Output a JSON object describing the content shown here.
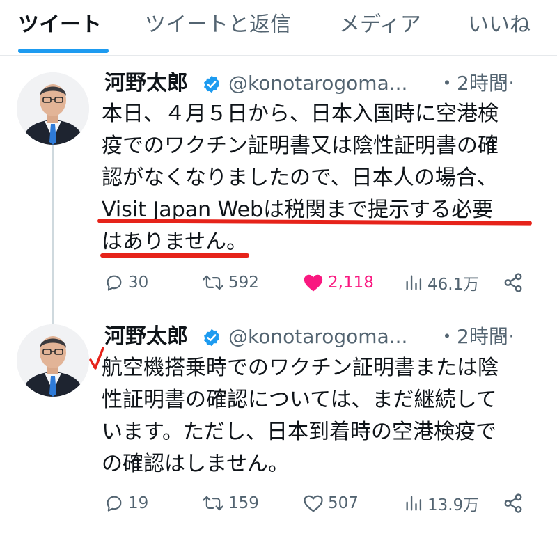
{
  "tabs": [
    {
      "label": "ツイート",
      "active": true
    },
    {
      "label": "ツイートと返信",
      "active": false
    },
    {
      "label": "メディア",
      "active": false
    },
    {
      "label": "いいね",
      "active": false
    }
  ],
  "accent_color": "#1d9bf0",
  "like_color": "#f91880",
  "annotation_color": "#e6231a",
  "tweets": [
    {
      "author_name": "河野太郎",
      "handle": "@konotarogoma...",
      "time": "・2時間",
      "more": "···",
      "lines": [
        "本日、４月５日から、日本入国時に空港検",
        "疫でのワクチン証明書又は陰性証明書の確",
        "認がなくなりましたので、日本人の場合、",
        "Visit Japan Webは税関まで提示する必要",
        "はありません。"
      ],
      "replies": "30",
      "retweets": "592",
      "likes": "2,118",
      "views": "46.1万",
      "liked": true
    },
    {
      "author_name": "河野太郎",
      "handle": "@konotarogoma...",
      "time": "・2時間",
      "more": "···",
      "lines": [
        "航空機搭乗時でのワクチン証明書または陰",
        "性証明書の確認については、まだ継続して",
        "います。ただし、日本到着時の空港検疫で",
        "の確認はしません。"
      ],
      "replies": "19",
      "retweets": "159",
      "likes": "507",
      "views": "13.9万",
      "liked": false
    }
  ]
}
